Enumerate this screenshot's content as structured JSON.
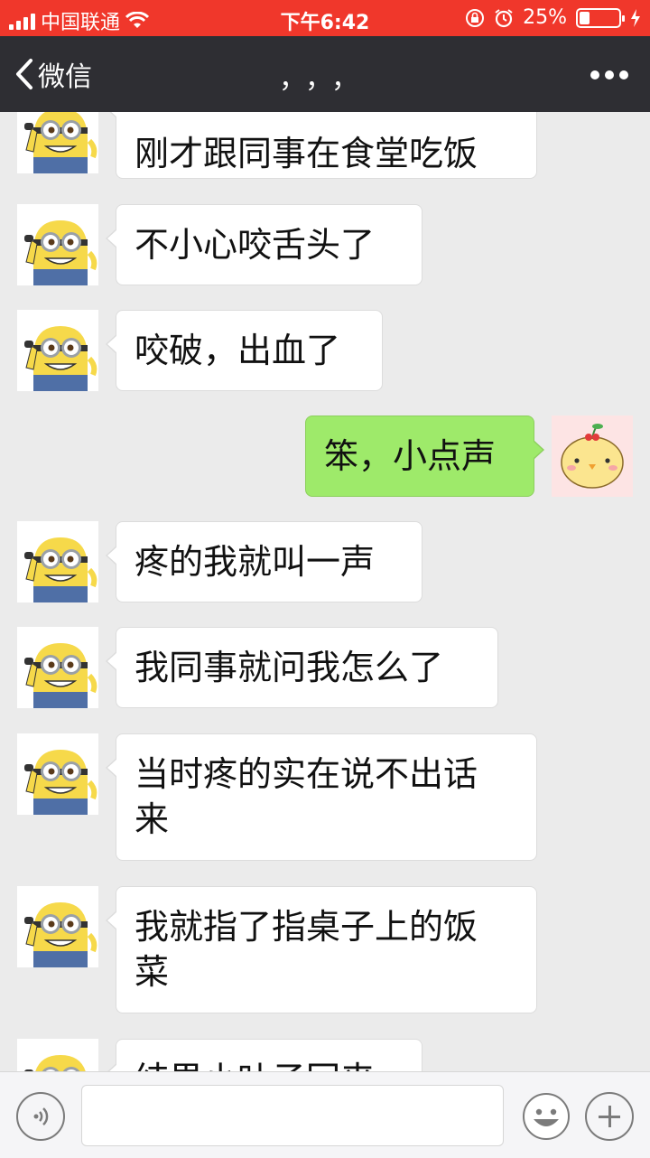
{
  "status_bar": {
    "carrier": "中国联通",
    "time": "下午6:42",
    "battery": "25%",
    "battery_level": 0.25,
    "icons": [
      "signal-icon",
      "wifi-icon",
      "rotation-lock-icon",
      "alarm-icon",
      "battery-icon",
      "charging-icon"
    ]
  },
  "nav": {
    "back_label": "微信",
    "title": "，，，",
    "more_icon": "more-icon"
  },
  "messages": [
    {
      "side": "left",
      "text": "刚才跟同事在食堂吃饭",
      "avatar": "minion-avatar"
    },
    {
      "side": "left",
      "text": "不小心咬舌头了",
      "avatar": "minion-avatar"
    },
    {
      "side": "left",
      "text": "咬破，出血了",
      "avatar": "minion-avatar"
    },
    {
      "side": "right",
      "text": "笨，小点声",
      "avatar": "chick-avatar"
    },
    {
      "side": "left",
      "text": "疼的我就叫一声",
      "avatar": "minion-avatar"
    },
    {
      "side": "left",
      "text": "我同事就问我怎么了",
      "avatar": "minion-avatar"
    },
    {
      "side": "left",
      "text": "当时疼的实在说不出话\n来",
      "avatar": "minion-avatar"
    },
    {
      "side": "left",
      "text": "我就指了指桌子上的饭\n菜",
      "avatar": "minion-avatar"
    },
    {
      "side": "left",
      "text": "结果小叶子回来",
      "avatar": "minion-avatar"
    }
  ],
  "input_bar": {
    "placeholder": "",
    "voice_icon": "voice-icon",
    "emoji_icon": "emoji-icon",
    "add_icon": "plus-icon"
  },
  "colors": {
    "status_bar_bg": "#f0372b",
    "nav_bg": "#2e2e33",
    "chat_bg": "#ebebeb",
    "sent_bubble": "#9eea6a",
    "received_bubble": "#ffffff"
  }
}
